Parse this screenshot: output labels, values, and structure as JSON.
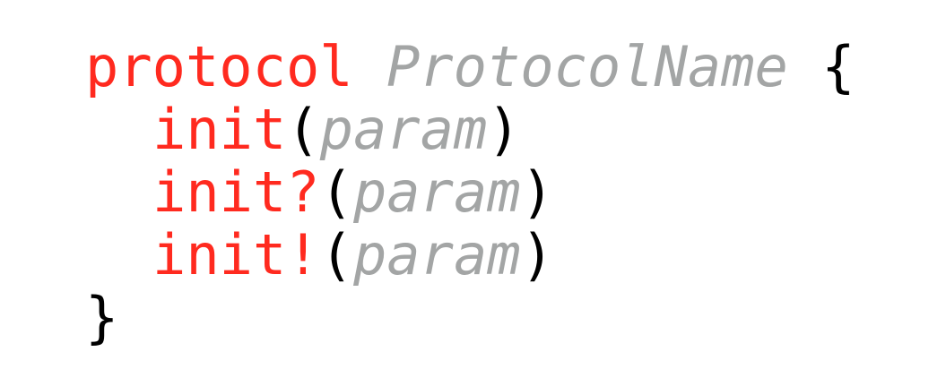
{
  "colors": {
    "keyword": "#ff2a1f",
    "placeholder": "#a3a5a5",
    "punctuation": "#000000",
    "background": "#ffffff"
  },
  "code": {
    "line1": {
      "keyword": "protocol",
      "space": " ",
      "name": "ProtocolName",
      "space2": " ",
      "brace": "{"
    },
    "line2": {
      "keyword": "init",
      "open": "(",
      "param": "param",
      "close": ")"
    },
    "line3": {
      "keyword": "init?",
      "open": "(",
      "param": "param",
      "close": ")"
    },
    "line4": {
      "keyword": "init!",
      "open": "(",
      "param": "param",
      "close": ")"
    },
    "line5": {
      "brace": "}"
    }
  }
}
